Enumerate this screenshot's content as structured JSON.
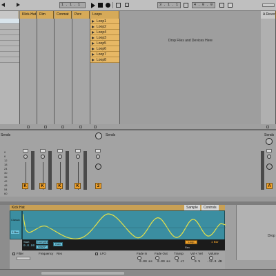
{
  "transport": {
    "position": "1 . 1 . 1",
    "loop_start": "3 . 1 . 1",
    "loop_length": "4 . 0 . 0",
    "play_icon": "play-icon",
    "stop_icon": "stop-icon",
    "record_icon": "record-icon"
  },
  "tracks": [
    {
      "name": "",
      "color": "#d6aa58"
    },
    {
      "name": "Klick-Hat",
      "color": "#d6aa58"
    },
    {
      "name": "Rim",
      "color": "#d6aa58"
    },
    {
      "name": "Conmat",
      "color": "#d6aa58"
    },
    {
      "name": "Perc",
      "color": "#d6aa58"
    },
    {
      "name": "Loops",
      "color": "#e7b865"
    }
  ],
  "loops": [
    "Loop1",
    "Loop2",
    "Loop4",
    "Loop3",
    "Loop5",
    "Loop6",
    "Loop7",
    "Loop8"
  ],
  "drop_hint": "Drop Files and Devices Here",
  "return_track": {
    "name": "A Reverb"
  },
  "mixer": {
    "sends_label": "Sends",
    "scale": [
      "0",
      "6",
      "12",
      "18",
      "24",
      "30",
      "36",
      "42",
      "48",
      "54",
      "60"
    ],
    "activator_labels": [
      "K",
      "K",
      "K",
      "K",
      "2",
      "A"
    ]
  },
  "clip": {
    "name": "Kick Hat",
    "tabs": [
      "Sample",
      "Controls"
    ],
    "left_buttons": [
      "Classic",
      "1-Bar"
    ],
    "start_label": "Start",
    "start_value": "0.0.00",
    "warp_buttons": [
      "Complex",
      "WARP",
      "Gain"
    ],
    "loop_button": "Loop",
    "end_value": "1 Bar",
    "reverse": "Rev",
    "filter_label": "Filter",
    "frequency_label": "Frequency",
    "res_label": "Res",
    "lfo_label": "LFO",
    "fade_in_label": "Fade In",
    "fade_in_value": "0.00 ms",
    "fade_out_label": "Fade Out",
    "fade_out_value": "0.00 ms",
    "transp_label": "Transp",
    "transp_value": "0 st",
    "vol_label": "Vol < Vel",
    "vol_value": "0 %",
    "volume_label": "Volume",
    "volume_value": "-12.0 dB"
  },
  "side_panel": {
    "text": "Drop"
  }
}
